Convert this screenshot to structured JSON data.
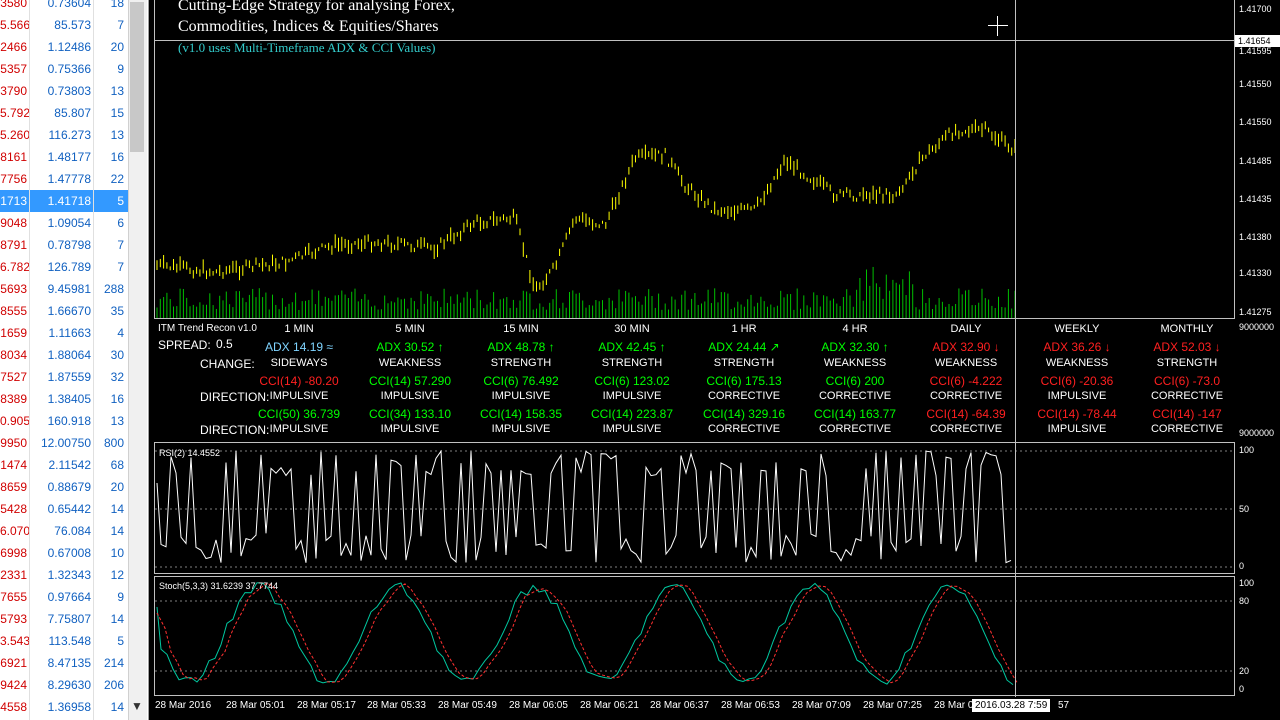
{
  "market_watch": {
    "rows": [
      {
        "a": "3580",
        "b": "0.73604",
        "c": "18"
      },
      {
        "a": "5.566",
        "b": "85.573",
        "c": "7"
      },
      {
        "a": "2466",
        "b": "1.12486",
        "c": "20"
      },
      {
        "a": "5357",
        "b": "0.75366",
        "c": "9"
      },
      {
        "a": "3790",
        "b": "0.73803",
        "c": "13"
      },
      {
        "a": "5.792",
        "b": "85.807",
        "c": "15"
      },
      {
        "a": "5.260",
        "b": "116.273",
        "c": "13"
      },
      {
        "a": "8161",
        "b": "1.48177",
        "c": "16"
      },
      {
        "a": "7756",
        "b": "1.47778",
        "c": "22"
      },
      {
        "a": "1713",
        "b": "1.41718",
        "c": "5",
        "sel": true
      },
      {
        "a": "9048",
        "b": "1.09054",
        "c": "6"
      },
      {
        "a": "8791",
        "b": "0.78798",
        "c": "7"
      },
      {
        "a": "6.782",
        "b": "126.789",
        "c": "7"
      },
      {
        "a": "5693",
        "b": "9.45981",
        "c": "288"
      },
      {
        "a": "8555",
        "b": "1.66670",
        "c": "35"
      },
      {
        "a": "1659",
        "b": "1.11663",
        "c": "4"
      },
      {
        "a": "8034",
        "b": "1.88064",
        "c": "30"
      },
      {
        "a": "7527",
        "b": "1.87559",
        "c": "32"
      },
      {
        "a": "8389",
        "b": "1.38405",
        "c": "16"
      },
      {
        "a": "0.905",
        "b": "160.918",
        "c": "13"
      },
      {
        "a": "9950",
        "b": "12.00750",
        "c": "800"
      },
      {
        "a": "1474",
        "b": "2.11542",
        "c": "68"
      },
      {
        "a": "8659",
        "b": "0.88679",
        "c": "20"
      },
      {
        "a": "5428",
        "b": "0.65442",
        "c": "14"
      },
      {
        "a": "6.070",
        "b": "76.084",
        "c": "14"
      },
      {
        "a": "6998",
        "b": "0.67008",
        "c": "10"
      },
      {
        "a": "2331",
        "b": "1.32343",
        "c": "12"
      },
      {
        "a": "7655",
        "b": "0.97664",
        "c": "9"
      },
      {
        "a": "5793",
        "b": "7.75807",
        "c": "14"
      },
      {
        "a": "3.543",
        "b": "113.548",
        "c": "5"
      },
      {
        "a": "6921",
        "b": "8.47135",
        "c": "214"
      },
      {
        "a": "9424",
        "b": "8.29630",
        "c": "206"
      },
      {
        "a": "4558",
        "b": "1.36958",
        "c": "14"
      }
    ],
    "scroll_down_glyph": "▼"
  },
  "header": {
    "line1": "Cutting-Edge Strategy for analysing Forex,",
    "line2": "Commodities, Indices & Equities/Shares",
    "line3": "(v1.0 uses Multi-Timeframe ADX & CCI Values)"
  },
  "price_axis": [
    "1.41700",
    "1.41654",
    "1.41595",
    "1.41550",
    "1.41485",
    "1.41435",
    "1.41380",
    "1.41330",
    "1.41275",
    "9000000",
    "9000000"
  ],
  "current_price": "1.41654",
  "dashboard": {
    "title": "ITM Trend Recon v1.0",
    "spread_label": "SPREAD:",
    "spread_value": "0.5",
    "change_label": "CHANGE:",
    "direction_label": "DIRECTION:",
    "columns": [
      {
        "tf": "1 MIN",
        "adx": "ADX 14.19 ≈",
        "adx_color": "c",
        "change": "SIDEWAYS",
        "cci1": "CCI(14) -80.20",
        "cci1_color": "r",
        "dir1": "IMPULSIVE",
        "cci2": "CCI(50) 36.739",
        "cci2_color": "g",
        "dir2": "IMPULSIVE"
      },
      {
        "tf": "5 MIN",
        "adx": "ADX 30.52 ↑",
        "adx_color": "g",
        "change": "WEAKNESS",
        "cci1": "CCI(14) 57.290",
        "cci1_color": "g",
        "dir1": "IMPULSIVE",
        "cci2": "CCI(34) 133.10",
        "cci2_color": "g",
        "dir2": "IMPULSIVE"
      },
      {
        "tf": "15 MIN",
        "adx": "ADX 48.78 ↑",
        "adx_color": "g",
        "change": "STRENGTH",
        "cci1": "CCI(6) 76.492",
        "cci1_color": "g",
        "dir1": "IMPULSIVE",
        "cci2": "CCI(14) 158.35",
        "cci2_color": "g",
        "dir2": "IMPULSIVE"
      },
      {
        "tf": "30 MIN",
        "adx": "ADX 42.45 ↑",
        "adx_color": "g",
        "change": "STRENGTH",
        "cci1": "CCI(6) 123.02",
        "cci1_color": "g",
        "dir1": "IMPULSIVE",
        "cci2": "CCI(14) 223.87",
        "cci2_color": "g",
        "dir2": "IMPULSIVE"
      },
      {
        "tf": "1 HR",
        "adx": "ADX 24.44 ↗",
        "adx_color": "g",
        "change": "STRENGTH",
        "cci1": "CCI(6) 175.13",
        "cci1_color": "g",
        "dir1": "CORRECTIVE",
        "cci2": "CCI(14) 329.16",
        "cci2_color": "g",
        "dir2": "CORRECTIVE"
      },
      {
        "tf": "4 HR",
        "adx": "ADX 32.30 ↑",
        "adx_color": "g",
        "change": "WEAKNESS",
        "cci1": "CCI(6) 200",
        "cci1_color": "g",
        "dir1": "CORRECTIVE",
        "cci2": "CCI(14) 163.77",
        "cci2_color": "g",
        "dir2": "CORRECTIVE"
      },
      {
        "tf": "DAILY",
        "adx": "ADX 32.90 ↓",
        "adx_color": "r",
        "change": "WEAKNESS",
        "cci1": "CCI(6) -4.222",
        "cci1_color": "r",
        "dir1": "CORRECTIVE",
        "cci2": "CCI(14) -64.39",
        "cci2_color": "r",
        "dir2": "CORRECTIVE"
      },
      {
        "tf": "WEEKLY",
        "adx": "ADX 36.26 ↓",
        "adx_color": "r",
        "change": "WEAKNESS",
        "cci1": "CCI(6) -20.36",
        "cci1_color": "r",
        "dir1": "IMPULSIVE",
        "cci2": "CCI(14) -78.44",
        "cci2_color": "r",
        "dir2": "IMPULSIVE"
      },
      {
        "tf": "MONTHLY",
        "adx": "ADX 52.03 ↓",
        "adx_color": "r",
        "change": "STRENGTH",
        "cci1": "CCI(6) -73.0",
        "cci1_color": "r",
        "dir1": "CORRECTIVE",
        "cci2": "CCI(14) -147",
        "cci2_color": "r",
        "dir2": "CORRECTIVE"
      }
    ]
  },
  "rsi": {
    "label": "RSI(2) 14.4552",
    "levels": [
      "100",
      "50",
      "0"
    ]
  },
  "stoch": {
    "label": "Stoch(5,3,3) 31.6239 37.7744",
    "levels": [
      "100",
      "80",
      "20",
      "0"
    ]
  },
  "time_axis": [
    "28 Mar 2016",
    "28 Mar 05:01",
    "28 Mar 05:17",
    "28 Mar 05:33",
    "28 Mar 05:49",
    "28 Mar 06:05",
    "28 Mar 06:21",
    "28 Mar 06:37",
    "28 Mar 06:53",
    "28 Mar 07:09",
    "28 Mar 07:25",
    "28 Mar 0"
  ],
  "cursor_date": "2016.03.28 7:59",
  "cursor_date_suffix": "57",
  "colors": {
    "candle": "#ffff00",
    "volume": "#00c000",
    "rsi": "#ffffff",
    "stoch_main": "#00c8a0",
    "stoch_signal": "#ff3030"
  }
}
